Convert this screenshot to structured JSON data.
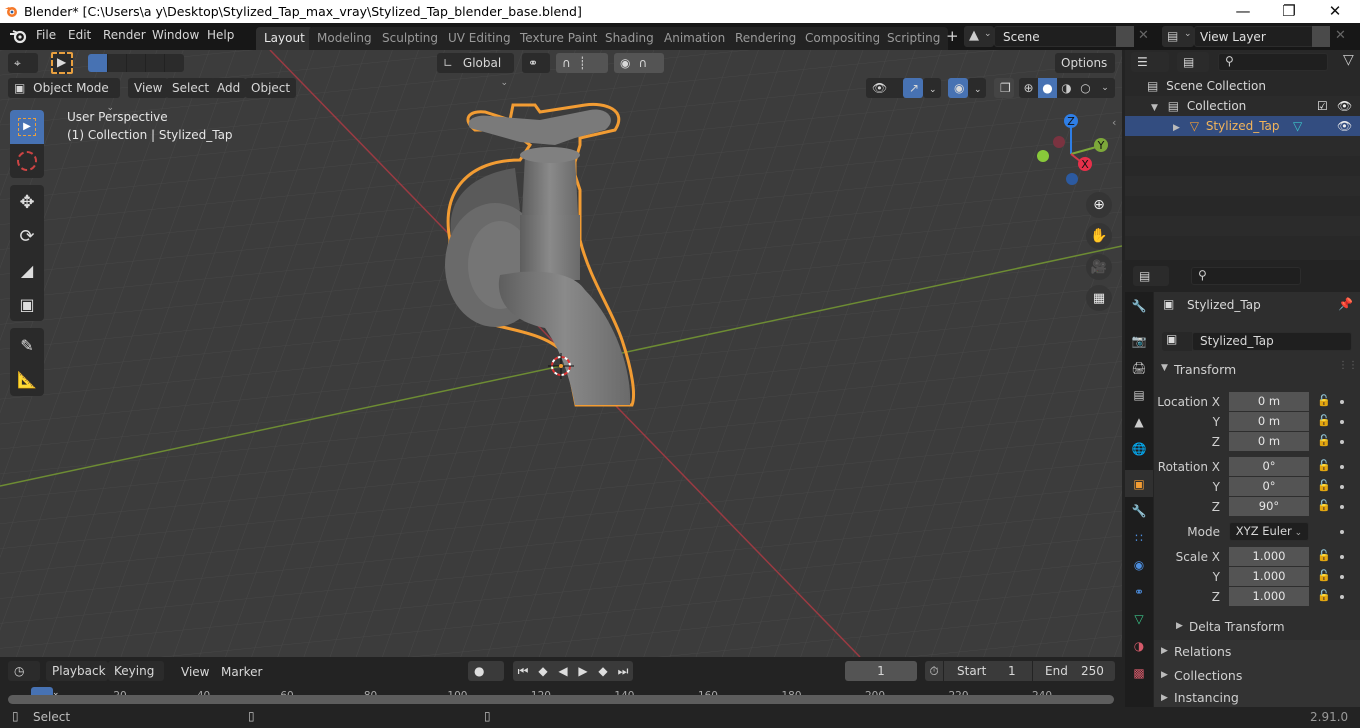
{
  "window": {
    "title": "Blender* [C:\\Users\\a y\\Desktop\\Stylized_Tap_max_vray\\Stylized_Tap_blender_base.blend]",
    "controls": [
      "minimize",
      "maximize",
      "close"
    ]
  },
  "menubar": {
    "items": [
      "File",
      "Edit",
      "Render",
      "Window",
      "Help"
    ]
  },
  "workspaces": {
    "tabs": [
      "Layout",
      "Modeling",
      "Sculpting",
      "UV Editing",
      "Texture Paint",
      "Shading",
      "Animation",
      "Rendering",
      "Compositing",
      "Scripting"
    ],
    "active": "Layout",
    "add_label": "+"
  },
  "scene": {
    "name": "Scene"
  },
  "view_layer": {
    "name": "View Layer"
  },
  "viewport_header": {
    "transform_orientation": "Global",
    "options_label": "Options",
    "mode": "Object Mode",
    "menus": [
      "View",
      "Select",
      "Add",
      "Object"
    ]
  },
  "viewport": {
    "overlay_line1": "User Perspective",
    "overlay_line2": "(1) Collection | Stylized_Tap",
    "gizmo": {
      "z": "Z",
      "y": "Y",
      "x": "X"
    },
    "colors": {
      "selection_outline": "#f29c33",
      "x_axis": "#d03a4a",
      "y_axis": "#7da83a",
      "z_axis": "#2e7ee6",
      "background": "#3c3c3c"
    }
  },
  "toolbar": {
    "tools": [
      "select-box",
      "cursor",
      "move",
      "rotate",
      "scale",
      "transform",
      "annotate",
      "measure"
    ],
    "active": "select-box"
  },
  "outliner": {
    "root": "Scene Collection",
    "collection": "Collection",
    "object": "Stylized_Tap"
  },
  "properties": {
    "object_name": "Stylized_Tap",
    "datablock_name": "Stylized_Tap",
    "transform": {
      "title": "Transform",
      "location": {
        "label": "Location X",
        "x": "0 m",
        "y": "0 m",
        "z": "0 m"
      },
      "rotation": {
        "label": "Rotation X",
        "x": "0°",
        "y": "0°",
        "z": "90°"
      },
      "mode_label": "Mode",
      "mode": "XYZ Euler",
      "scale": {
        "label": "Scale X",
        "x": "1.000",
        "y": "1.000",
        "z": "1.000"
      },
      "axis_y": "Y",
      "axis_z": "Z",
      "delta": "Delta Transform"
    },
    "sections": [
      "Relations",
      "Collections",
      "Instancing"
    ]
  },
  "timeline": {
    "menus": [
      "Playback",
      "Keying",
      "View",
      "Marker"
    ],
    "current_frame": "1",
    "start_label": "Start",
    "start": "1",
    "end_label": "End",
    "end": "250",
    "ticks": [
      "1",
      "20",
      "40",
      "60",
      "80",
      "100",
      "120",
      "140",
      "160",
      "180",
      "200",
      "220",
      "240"
    ]
  },
  "statusbar": {
    "left_action": "Select",
    "version": "2.91.0"
  }
}
